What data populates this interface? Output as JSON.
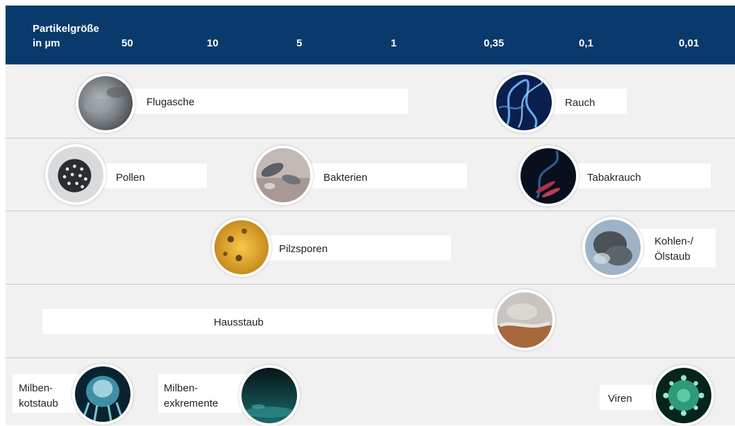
{
  "header": {
    "title_line1": "Partikelgröße",
    "title_line2": "in µm",
    "scale": [
      "50",
      "10",
      "5",
      "1",
      "0,35",
      "0,1",
      "0,01"
    ]
  },
  "particles": {
    "flugasche": "Flugasche",
    "rauch": "Rauch",
    "pollen": "Pollen",
    "bakterien": "Bakterien",
    "tabakrauch": "Tabakrauch",
    "pilzsporen": "Pilzsporen",
    "kohlen_line1": "Kohlen-/",
    "kohlen_line2": "Ölstaub",
    "hausstaub": "Hausstaub",
    "milbenkot_line1": "Milben-",
    "milbenkot_line2": "kotstaub",
    "milbenexk_line1": "Milben-",
    "milbenexk_line2": "exkremente",
    "viren": "Viren"
  },
  "colors": {
    "header_bg": "#0a3a6b",
    "band_bg": "#f1f1f1"
  },
  "icons": [
    "ash-photo-icon",
    "smoke-photo-icon",
    "pollen-photo-icon",
    "bacteria-photo-icon",
    "tobacco-smoke-photo-icon",
    "spores-photo-icon",
    "soot-photo-icon",
    "housedust-photo-icon",
    "mite-photo-icon",
    "mite-excrement-photo-icon",
    "virus-photo-icon"
  ]
}
